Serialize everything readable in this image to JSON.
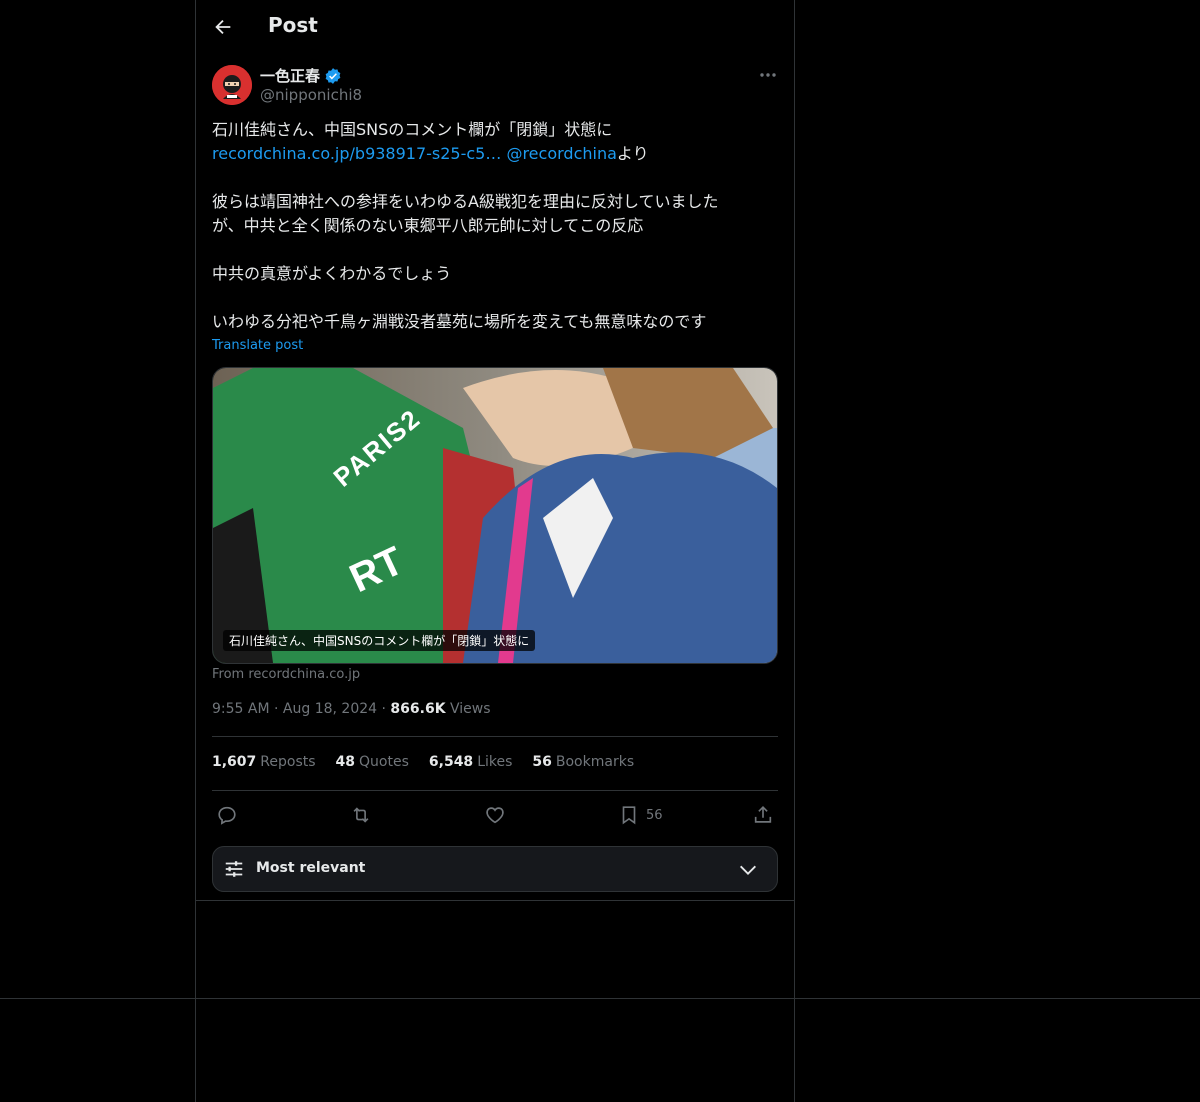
{
  "header": {
    "title": "Post"
  },
  "author": {
    "display_name": "一色正春",
    "handle": "@nipponichi8",
    "verified": true
  },
  "post": {
    "line1": "石川佳純さん、中国SNSのコメント欄が「閉鎖」状態に",
    "link_text": "recordchina.co.jp/b938917-s25-c5…",
    "mention": "@recordchina",
    "mention_suffix": "より",
    "para2_line1": "彼らは靖国神社への参拝をいわゆるA級戦犯を理由に反対していました",
    "para2_line2": "が、中共と全く関係のない東郷平八郎元帥に対してこの反応",
    "para3": "中共の真意がよくわかるでしょう",
    "para4": "いわゆる分祀や千鳥ヶ淵戦没者墓苑に場所を変えても無意味なのです",
    "translate_label": "Translate post"
  },
  "media": {
    "caption": "石川佳純さん、中国SNSのコメント欄が「閉鎖」状態に",
    "vest_text": "PARIS2",
    "vest_text2": "RT",
    "source": "From recordchina.co.jp"
  },
  "meta": {
    "time": "9:55 AM",
    "dot": "·",
    "date": "Aug 18, 2024",
    "views_count": "866.6K",
    "views_label": "Views"
  },
  "stats": [
    {
      "count": "1,607",
      "label": "Reposts"
    },
    {
      "count": "48",
      "label": "Quotes"
    },
    {
      "count": "6,548",
      "label": "Likes"
    },
    {
      "count": "56",
      "label": "Bookmarks"
    }
  ],
  "actions": {
    "reply_icon": "reply-icon",
    "repost_icon": "repost-icon",
    "like_icon": "heart-icon",
    "bookmark_icon": "bookmark-icon",
    "bookmark_count": "56",
    "share_icon": "share-icon"
  },
  "sort": {
    "label": "Most relevant"
  },
  "colors": {
    "accent": "#1d9bf0",
    "background": "#000000",
    "muted": "#71767b",
    "border": "#2f3336"
  }
}
